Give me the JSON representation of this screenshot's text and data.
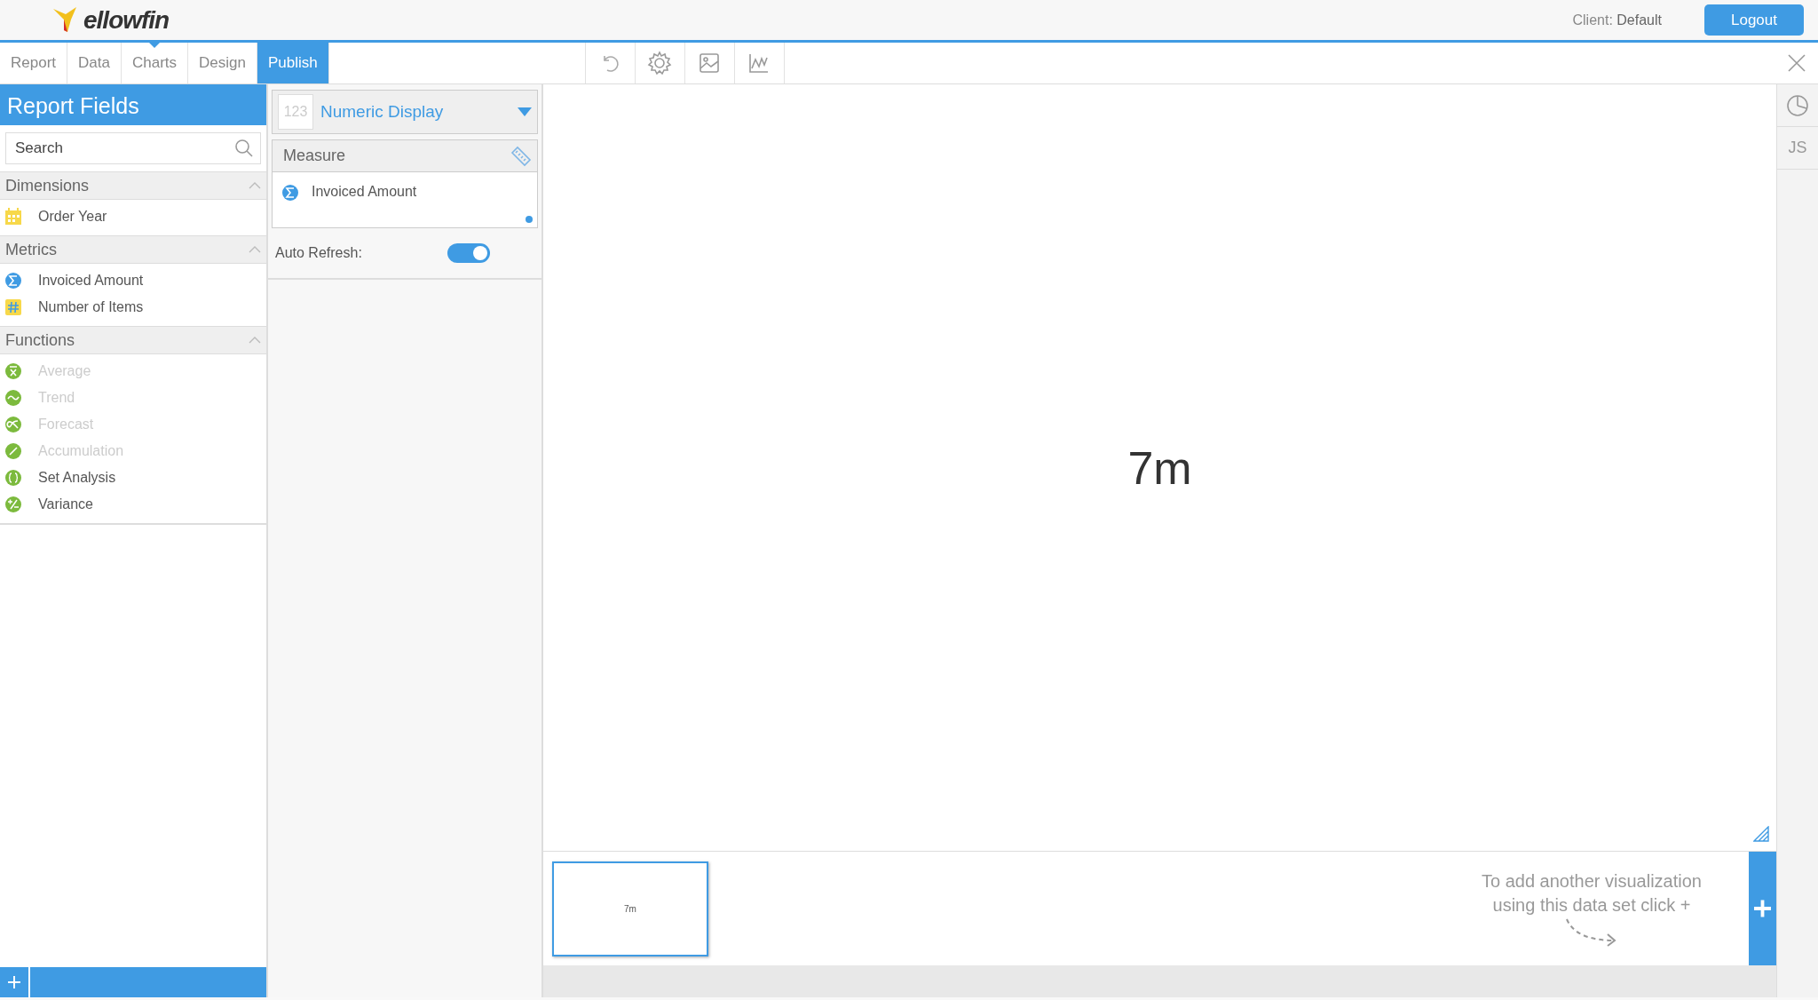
{
  "header": {
    "logo_text": "ellowfin",
    "client_label": "Client:",
    "client_value": "Default",
    "logout": "Logout"
  },
  "tabs": [
    {
      "label": "Report",
      "selected": false
    },
    {
      "label": "Data",
      "selected": false
    },
    {
      "label": "Charts",
      "selected": false,
      "pointer": true
    },
    {
      "label": "Design",
      "selected": false
    },
    {
      "label": "Publish",
      "selected": true
    }
  ],
  "sidebar": {
    "title": "Report Fields",
    "search": {
      "placeholder": "Search"
    },
    "sections": [
      {
        "title": "Dimensions",
        "expanded": true,
        "items": [
          {
            "label": "Order Year",
            "kind": "date",
            "disabled": false
          }
        ]
      },
      {
        "title": "Metrics",
        "expanded": true,
        "items": [
          {
            "label": "Invoiced Amount",
            "kind": "sum",
            "disabled": false
          },
          {
            "label": "Number of Items",
            "kind": "count",
            "disabled": false
          }
        ]
      },
      {
        "title": "Functions",
        "expanded": true,
        "items": [
          {
            "label": "Average",
            "kind": "average",
            "disabled": true
          },
          {
            "label": "Trend",
            "kind": "trend",
            "disabled": true
          },
          {
            "label": "Forecast",
            "kind": "forecast",
            "disabled": true
          },
          {
            "label": "Accumulation",
            "kind": "accumulation",
            "disabled": true
          },
          {
            "label": "Set Analysis",
            "kind": "set",
            "disabled": false
          },
          {
            "label": "Variance",
            "kind": "variance",
            "disabled": false
          }
        ]
      }
    ]
  },
  "config": {
    "chart_type_icon": "123",
    "chart_type": "Numeric Display",
    "measure_title": "Measure",
    "measure_field": "Invoiced Amount",
    "auto_refresh_label": "Auto Refresh:",
    "auto_refresh": true
  },
  "canvas": {
    "value": "7m"
  },
  "thumbnails": [
    {
      "value": "7m",
      "selected": true
    }
  ],
  "hint": "To add another visualization using this data set click +",
  "right_rail": {
    "js_label": "JS"
  }
}
